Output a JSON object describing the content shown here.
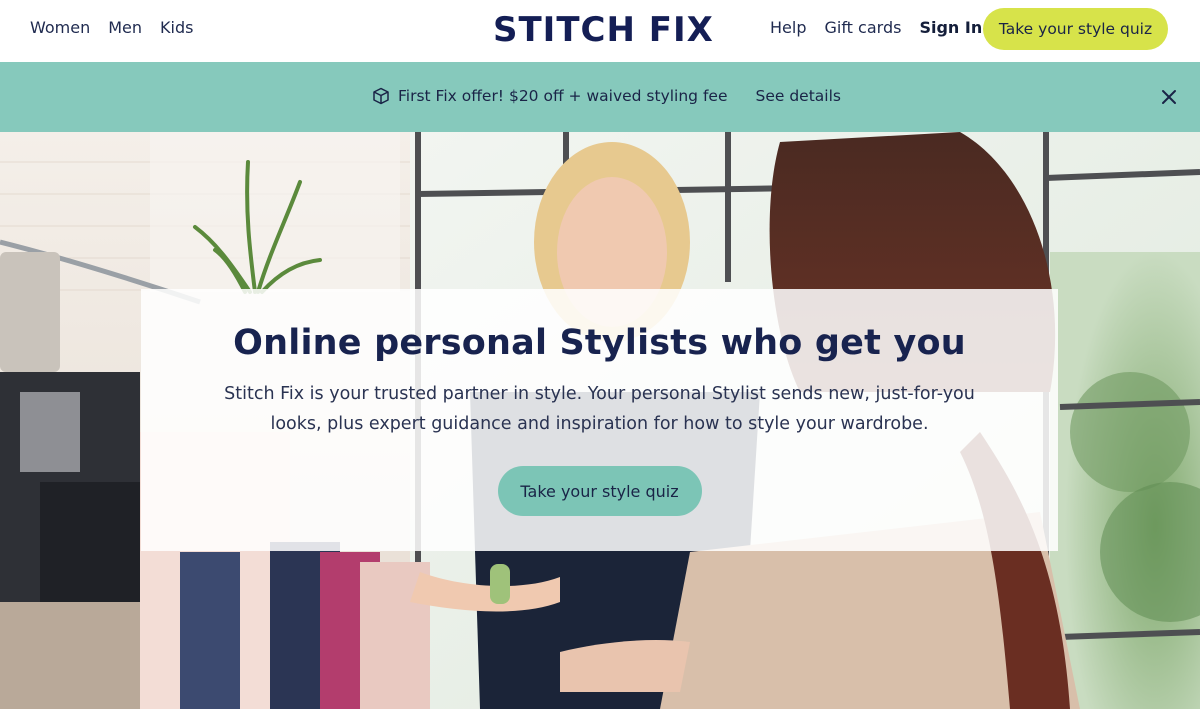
{
  "header": {
    "nav_left": [
      "Women",
      "Men",
      "Kids"
    ],
    "logo_text": "STITCH FIX",
    "nav_right": [
      "Help",
      "Gift cards",
      "Sign In"
    ],
    "cta_label": "Take your style quiz"
  },
  "promo": {
    "icon": "box-icon",
    "text": "First Fix offer! $20 off + waived styling fee",
    "link": "See details",
    "close_icon": "close-icon"
  },
  "hero": {
    "title": "Online personal Stylists who get you",
    "body": "Stitch Fix is your trusted partner in style. Your personal Stylist sends new, just-for-you looks, plus expert guidance and inspiration for how to style  your wardrobe.",
    "cta_label": "Take your style quiz"
  },
  "colors": {
    "brand_navy": "#141e55",
    "cta_yellow": "#d7e34a",
    "promo_teal": "#86c9bc",
    "hero_button_teal": "#7cc5b6"
  }
}
